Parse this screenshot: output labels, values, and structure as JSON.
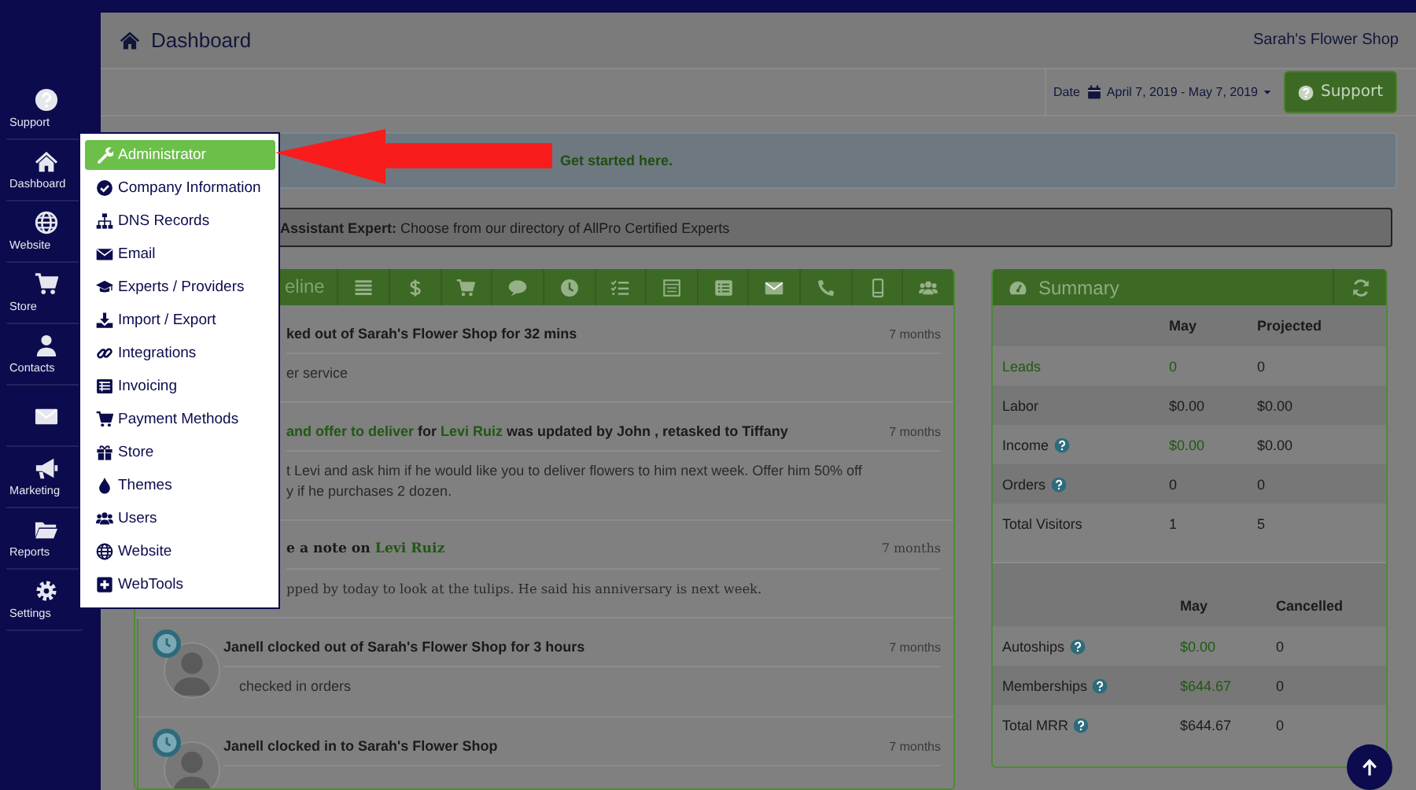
{
  "sidebar": {
    "items": [
      {
        "label": "Support",
        "selected": false
      },
      {
        "label": "Dashboard",
        "selected": false
      },
      {
        "label": "Website",
        "selected": false
      },
      {
        "label": "Store",
        "selected": false
      },
      {
        "label": "Contacts",
        "selected": false
      },
      {
        "selected": false
      },
      {
        "label": "Marketing",
        "selected": false
      },
      {
        "label": "Reports",
        "selected": false
      },
      {
        "label": "Settings",
        "selected": false
      }
    ]
  },
  "header": {
    "title": "Dashboard",
    "shop": "Sarah's Flower Shop"
  },
  "toolbar": {
    "date_label": "Date",
    "date_range": "April 7, 2019 - May 7, 2019",
    "support_button": "Support"
  },
  "alerts": [
    {
      "kind": "info",
      "text": "Get started here."
    },
    {
      "kind": "expert",
      "text": "**Assistant Expert:** Choose from our directory of AllPro Certified Experts"
    }
  ],
  "timeline": {
    "header_label": "eline",
    "entries": [
      {
        "kind": "activity",
        "avatar": false,
        "title": [
          {
            "text": "ked out of Sarah's Flower Shop for 32 mins",
            "link": false
          }
        ],
        "time": "7 months",
        "body": [
          "er service"
        ]
      },
      {
        "kind": "activity",
        "avatar": false,
        "title": [
          {
            "text": "and offer to deliver",
            "link": true
          },
          {
            "text": " for ",
            "link": false
          },
          {
            "text": "Levi Ruiz",
            "link": true
          },
          {
            "text": " was updated by John , retasked to Tiffany",
            "link": false
          }
        ],
        "time": "7 months",
        "body": [
          "t Levi and ask him if he would like you to deliver flowers to him next week.  Offer him 50% off",
          "y if he purchases 2 dozen."
        ]
      },
      {
        "kind": "note",
        "avatar": false,
        "title": [
          {
            "text": "e a note on ",
            "link": false
          },
          {
            "text": "Levi Ruiz",
            "link": true
          }
        ],
        "time": "7 months",
        "body": [
          "pped by today to look at the tulips. He said his anniversary is next week."
        ]
      },
      {
        "kind": "activity",
        "avatar": true,
        "title": [
          {
            "text": "Janell clocked out of Sarah's Flower Shop for 3 hours",
            "link": false
          }
        ],
        "time": "7 months",
        "body": [
          "checked in orders"
        ]
      },
      {
        "kind": "activity",
        "avatar": true,
        "title": [
          {
            "text": "Janell clocked in to Sarah's Flower Shop",
            "link": false
          }
        ],
        "time": "7 months"
      }
    ]
  },
  "summary": {
    "title": "Summary",
    "sections": [
      {
        "columns": [
          "May",
          "Projected"
        ],
        "rows": [
          {
            "label": "Leads",
            "link": true,
            "help": false,
            "cells": [
              {
                "text": "0",
                "link": true
              },
              {
                "text": "0",
                "link": false
              }
            ]
          },
          {
            "label": "Labor",
            "link": false,
            "help": false,
            "cells": [
              {
                "text": "$0.00",
                "link": false
              },
              {
                "text": "$0.00",
                "link": false
              }
            ]
          },
          {
            "label": "Income",
            "link": false,
            "help": true,
            "cells": [
              {
                "text": "$0.00",
                "link": true
              },
              {
                "text": "$0.00",
                "link": false
              }
            ]
          },
          {
            "label": "Orders",
            "link": false,
            "help": true,
            "cells": [
              {
                "text": "0",
                "link": false
              },
              {
                "text": "0",
                "link": false
              }
            ]
          },
          {
            "label": "Total Visitors",
            "link": false,
            "help": false,
            "cells": [
              {
                "text": "1",
                "link": false
              },
              {
                "text": "5",
                "link": false
              }
            ]
          }
        ]
      },
      {
        "columns": [
          "May",
          "Cancelled"
        ],
        "rows": [
          {
            "label": "Autoships",
            "link": false,
            "help": true,
            "cells": [
              {
                "text": "$0.00",
                "link": true
              },
              {
                "text": "0",
                "link": false
              }
            ]
          },
          {
            "label": "Memberships",
            "link": false,
            "help": true,
            "cells": [
              {
                "text": "$644.67",
                "link": true
              },
              {
                "text": "0",
                "link": false
              }
            ]
          },
          {
            "label": "Total MRR",
            "link": false,
            "help": true,
            "cells": [
              {
                "text": "$644.67",
                "link": false
              },
              {
                "text": "0",
                "link": false
              }
            ]
          }
        ]
      }
    ]
  },
  "menu": {
    "items": [
      {
        "label": "Administrator",
        "selected": true
      },
      {
        "label": "Company Information",
        "selected": false
      },
      {
        "label": "DNS Records",
        "selected": false
      },
      {
        "label": "Email",
        "selected": false
      },
      {
        "label": "Experts / Providers",
        "selected": false
      },
      {
        "label": "Import / Export",
        "selected": false
      },
      {
        "label": "Integrations",
        "selected": false
      },
      {
        "label": "Invoicing",
        "selected": false
      },
      {
        "label": "Payment Methods",
        "selected": false
      },
      {
        "label": "Store",
        "selected": false
      },
      {
        "label": "Themes",
        "selected": false
      },
      {
        "label": "Users",
        "selected": false
      },
      {
        "label": "Website",
        "selected": false
      },
      {
        "label": "WebTools",
        "selected": false
      }
    ]
  },
  "callout": {
    "kind": "arrow"
  }
}
